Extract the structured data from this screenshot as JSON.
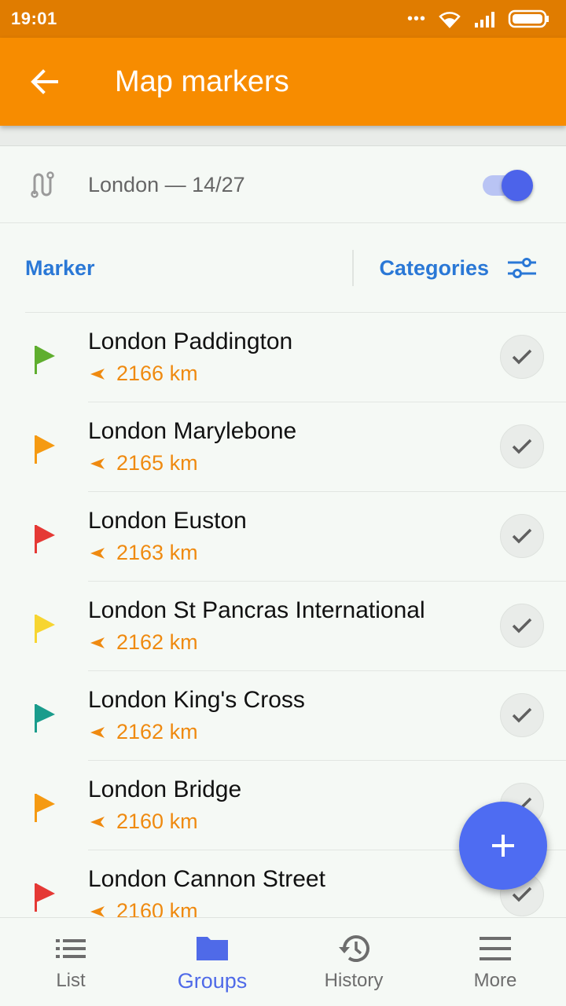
{
  "status_bar": {
    "time": "19:01",
    "dots": "•••"
  },
  "app_bar": {
    "title": "Map markers"
  },
  "group": {
    "label": "London — 14/27",
    "enabled": true
  },
  "columns": {
    "marker": "Marker",
    "categories": "Categories"
  },
  "colors": {
    "accent_orange": "#f78c00",
    "status_orange": "#e07c00",
    "blue": "#2a78d6",
    "toggle_blue": "#4c63ea",
    "fab_blue": "#4e6cf2",
    "distance_orange": "#ef8a10"
  },
  "markers": [
    {
      "name": "London Paddington",
      "distance": "2166 km",
      "flag_color": "#5fae2e",
      "flag_icon": "flag-icon"
    },
    {
      "name": "London Marylebone",
      "distance": "2165 km",
      "flag_color": "#f59a12",
      "flag_icon": "flag-icon"
    },
    {
      "name": "London Euston",
      "distance": "2163 km",
      "flag_color": "#e53935",
      "flag_icon": "flag-icon"
    },
    {
      "name": "London St Pancras International",
      "distance": "2162 km",
      "flag_color": "#f7d531",
      "flag_icon": "flag-icon"
    },
    {
      "name": "London King's Cross",
      "distance": "2162 km",
      "flag_color": "#1a9c8c",
      "flag_icon": "flag-icon"
    },
    {
      "name": "London Bridge",
      "distance": "2160 km",
      "flag_color": "#f59a12",
      "flag_icon": "flag-icon"
    },
    {
      "name": "London Cannon Street",
      "distance": "2160 km",
      "flag_color": "#e53935",
      "flag_icon": "flag-icon"
    }
  ],
  "bottom_nav": [
    {
      "label": "List",
      "icon": "list-icon",
      "active": false
    },
    {
      "label": "Groups",
      "icon": "folder-icon",
      "active": true
    },
    {
      "label": "History",
      "icon": "history-icon",
      "active": false
    },
    {
      "label": "More",
      "icon": "menu-icon",
      "active": false
    }
  ]
}
